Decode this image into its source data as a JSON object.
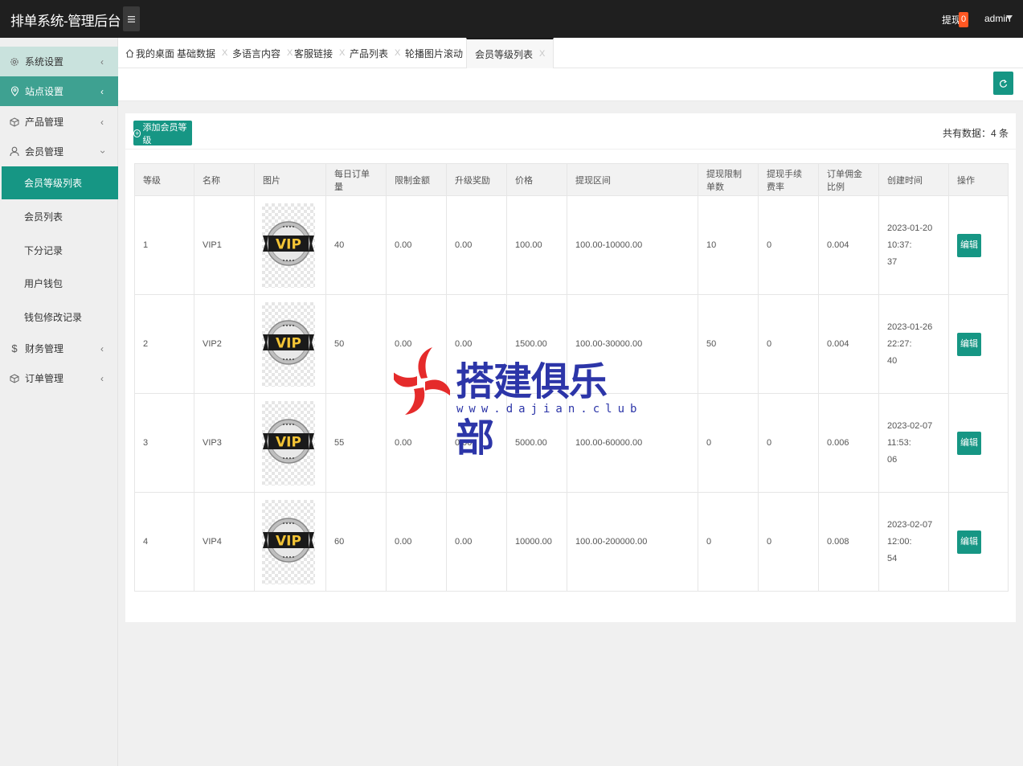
{
  "app": {
    "title": "排单系统-管理后台"
  },
  "header": {
    "withdraw_label": "提现",
    "withdraw_count": "0",
    "user": "admin"
  },
  "sidebar": {
    "items": [
      {
        "label": "系统设置",
        "icon": "gear-icon"
      },
      {
        "label": "站点设置",
        "icon": "location-icon"
      },
      {
        "label": "产品管理",
        "icon": "cube-icon"
      },
      {
        "label": "会员管理",
        "icon": "user-icon"
      },
      {
        "label": "财务管理",
        "icon": "dollar-icon"
      },
      {
        "label": "订单管理",
        "icon": "cube-icon"
      }
    ],
    "sub_items": [
      "会员等级列表",
      "会员列表",
      "下分记录",
      "用户钱包",
      "钱包修改记录"
    ]
  },
  "tabs": [
    {
      "label": "我的桌面"
    },
    {
      "label": "基础数据"
    },
    {
      "label": "多语言内容"
    },
    {
      "label": "客服链接"
    },
    {
      "label": "产品列表"
    },
    {
      "label": "轮播图片滚动"
    },
    {
      "label": "会员等级列表"
    }
  ],
  "toolbar": {
    "add_label": "添加会员等级",
    "total_label": "共有数据：4 条"
  },
  "table": {
    "columns": [
      "等级",
      "名称",
      "图片",
      "每日订单量",
      "限制金额",
      "升级奖励",
      "价格",
      "提现区间",
      "提现限制单数",
      "提现手续费率",
      "订单佣金比例",
      "创建时间",
      "操作"
    ],
    "rows": [
      {
        "level": "1",
        "name": "VIP1",
        "image_text": "VIP",
        "daily_orders": "40",
        "limit_amount": "0.00",
        "upgrade_reward": "0.00",
        "price": "100.00",
        "withdraw_range": "100.00-10000.00",
        "withdraw_limit_count": "10",
        "withdraw_fee_rate": "0",
        "commission_rate": "0.004",
        "created_line1": "2023-01-20 10:37:",
        "created_line2": "37",
        "action": "编辑"
      },
      {
        "level": "2",
        "name": "VIP2",
        "image_text": "VIP",
        "daily_orders": "50",
        "limit_amount": "0.00",
        "upgrade_reward": "0.00",
        "price": "1500.00",
        "withdraw_range": "100.00-30000.00",
        "withdraw_limit_count": "50",
        "withdraw_fee_rate": "0",
        "commission_rate": "0.004",
        "created_line1": "2023-01-26 22:27:",
        "created_line2": "40",
        "action": "编辑"
      },
      {
        "level": "3",
        "name": "VIP3",
        "image_text": "VIP",
        "daily_orders": "55",
        "limit_amount": "0.00",
        "upgrade_reward": "0.00",
        "price": "5000.00",
        "withdraw_range": "100.00-60000.00",
        "withdraw_limit_count": "0",
        "withdraw_fee_rate": "0",
        "commission_rate": "0.006",
        "created_line1": "2023-02-07 11:53:",
        "created_line2": "06",
        "action": "编辑"
      },
      {
        "level": "4",
        "name": "VIP4",
        "image_text": "VIP",
        "daily_orders": "60",
        "limit_amount": "0.00",
        "upgrade_reward": "0.00",
        "price": "10000.00",
        "withdraw_range": "100.00-200000.00",
        "withdraw_limit_count": "0",
        "withdraw_fee_rate": "0",
        "commission_rate": "0.008",
        "created_line1": "2023-02-07 12:00:",
        "created_line2": "54",
        "action": "编辑"
      }
    ]
  },
  "watermark": {
    "title": "搭建俱乐部",
    "url": "www.dajian.club"
  },
  "colors": {
    "accent": "#169684",
    "topbar": "#1f1f1f",
    "badge": "#ff5722",
    "watermark_blue": "#2c35a8",
    "watermark_red": "#e52b2b"
  }
}
